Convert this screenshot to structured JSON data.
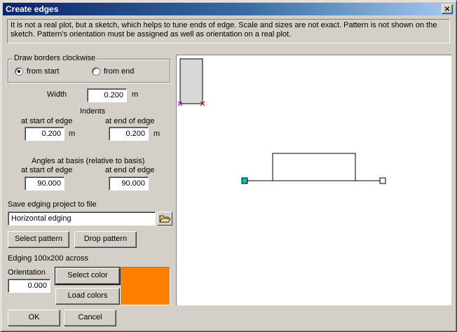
{
  "window": {
    "title": "Create edges",
    "close_glyph": "×"
  },
  "note": "It is not a real plot, but a sketch, which helps to tune ends of edge. Scale and sizes are not exact. Pattern is not shown on the sketch. Pattern's orientation must be assigned as well as orientation on a real plot.",
  "borders": {
    "group_label": "Draw borders clockwise",
    "options": [
      {
        "label": "from start",
        "selected": true
      },
      {
        "label": "from end",
        "selected": false
      }
    ]
  },
  "width": {
    "label": "Width",
    "value": "0.200",
    "unit": "m"
  },
  "indents": {
    "label": "Indents",
    "start_label": "at start of edge",
    "start_value": "0.200",
    "start_unit": "m",
    "end_label": "at end of edge",
    "end_value": "0.200",
    "end_unit": "m"
  },
  "angles": {
    "label": "Angles at basis (relative to basis)",
    "start_label": "at start of edge",
    "start_value": "90.000",
    "end_label": "at end of edge",
    "end_value": "90.000"
  },
  "save": {
    "label": "Save edging project to file",
    "file_value": "Horizontal edging",
    "browse_icon": "folder-open-icon"
  },
  "pattern": {
    "select_label": "Select pattern",
    "drop_label": "Drop pattern",
    "name": "Edging 100x200 across"
  },
  "orientation": {
    "label": "Orientation",
    "value": "0.000"
  },
  "color": {
    "select_label": "Select color",
    "load_label": "Load colors",
    "value": "#ff8000"
  },
  "footer": {
    "ok_label": "OK",
    "cancel_label": "Cancel"
  },
  "sketch": {
    "start_marker_color": "#00c0c0",
    "cross_colors": [
      "#c000c0",
      "#e00000"
    ]
  }
}
